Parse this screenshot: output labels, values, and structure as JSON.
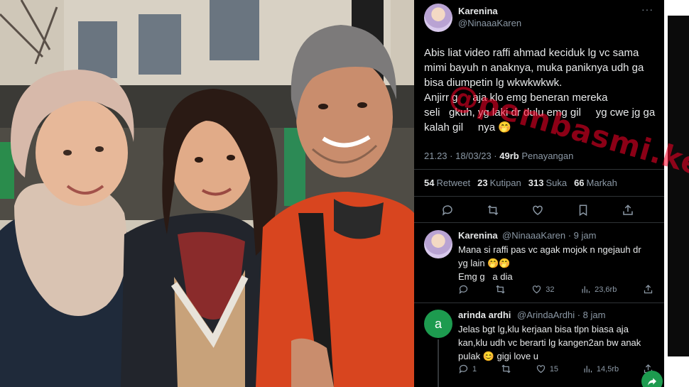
{
  "main_tweet": {
    "name": "Karenina",
    "handle": "@NinaaaKaren",
    "more": "···",
    "text": "Abis liat video raffi ahmad keciduk lg vc sama\nmimi bayuh n anaknya, muka paniknya udh ga\nbisa diumpetin lg wkwkwkwk.\nAnjirr g     aja klo emg beneran mereka\nseli   gkuh, yg laki dr dulu emg gil     yg cwe jg ga\nkalah gil     nya 🤭",
    "time": "21.23 · 18/03/23 · ",
    "views_count": "49rb",
    "views_label": " Penayangan",
    "stats": [
      {
        "count": "54",
        "label": "Retweet"
      },
      {
        "count": "23",
        "label": "Kutipan"
      },
      {
        "count": "313",
        "label": "Suka"
      },
      {
        "count": "66",
        "label": "Markah"
      }
    ]
  },
  "reply1": {
    "name": "Karenina",
    "handle": "@NinaaaKaren · 9 jam",
    "text": "Mana si raffi pas vc agak mojok n ngejauh dr\nyg lain 🤭🤭\nEmg g   a dia",
    "likes": "32",
    "views": "23,6rb"
  },
  "reply2": {
    "avatar_letter": "a",
    "name": "arinda ardhi",
    "handle": "@ArindaArdhi · 8 jam",
    "text": "Jelas bgt lg,klu kerjaan bisa tlpn biasa aja\nkan,klu udh vc berarti lg kangen2an bw anak\npulak 😊 gigi love u",
    "replies": "1",
    "likes": "15",
    "views": "14,5rb"
  },
  "watermark": "@pembasmi.ke",
  "colors": {
    "background": "#000000",
    "text": "#e7e9ea",
    "muted": "#8b98a5",
    "divider": "#2f3336",
    "watermark": "#ff0028",
    "green": "#1d9b4f"
  }
}
